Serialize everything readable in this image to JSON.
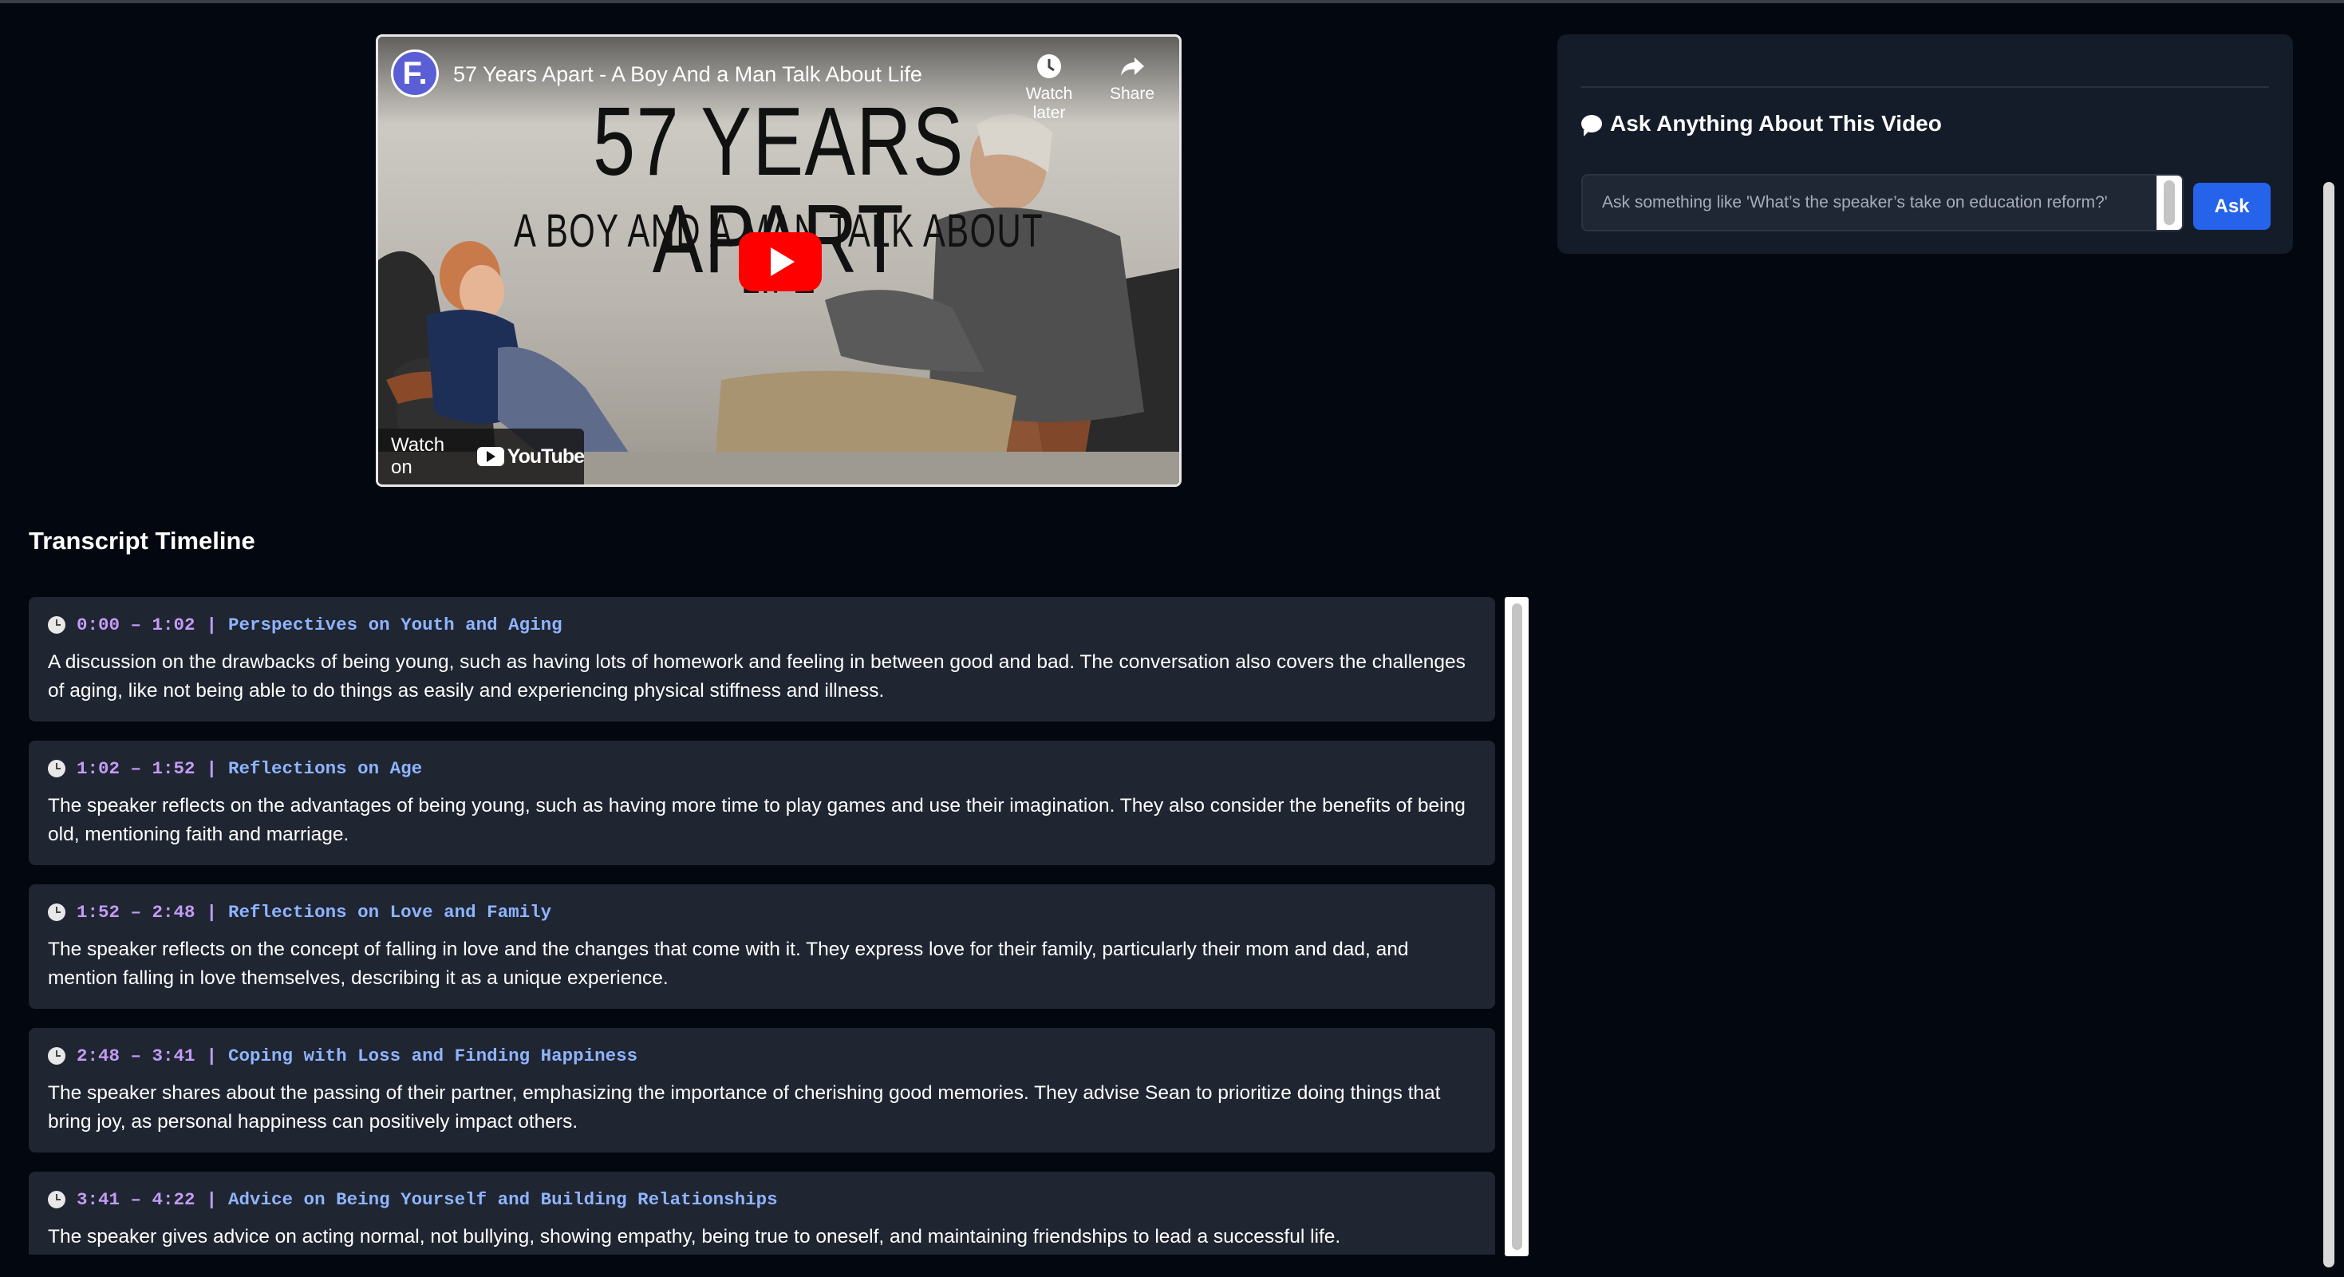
{
  "video": {
    "title": "57 Years Apart - A Boy And a Man Talk About Life",
    "channel_initial": "F.",
    "thumbnail_title": "57 YEARS APART",
    "thumbnail_subtitle": "A BOY AND A MAN TALK ABOUT LIFE",
    "watch_later_label": "Watch later",
    "share_label": "Share",
    "watch_on_label": "Watch on",
    "youtube_label": "YouTube"
  },
  "transcript": {
    "heading": "Transcript Timeline",
    "separator": "|",
    "segments": [
      {
        "time": "0:00 – 1:02",
        "topic": "Perspectives on Youth and Aging",
        "summary": "A discussion on the drawbacks of being young, such as having lots of homework and feeling in between good and bad. The conversation also covers the challenges of aging, like not being able to do things as easily and experiencing physical stiffness and illness."
      },
      {
        "time": "1:02 – 1:52",
        "topic": "Reflections on Age",
        "summary": "The speaker reflects on the advantages of being young, such as having more time to play games and use their imagination. They also consider the benefits of being old, mentioning faith and marriage."
      },
      {
        "time": "1:52 – 2:48",
        "topic": "Reflections on Love and Family",
        "summary": "The speaker reflects on the concept of falling in love and the changes that come with it. They express love for their family, particularly their mom and dad, and mention falling in love themselves, describing it as a unique experience."
      },
      {
        "time": "2:48 – 3:41",
        "topic": "Coping with Loss and Finding Happiness",
        "summary": "The speaker shares about the passing of their partner, emphasizing the importance of cherishing good memories. They advise Sean to prioritize doing things that bring joy, as personal happiness can positively impact others."
      },
      {
        "time": "3:41 – 4:22",
        "topic": "Advice on Being Yourself and Building Relationships",
        "summary": "The speaker gives advice on acting normal, not bullying, showing empathy, being true to oneself, and maintaining friendships to lead a successful life."
      }
    ]
  },
  "ask": {
    "title": "Ask Anything About This Video",
    "placeholder": "Ask something like 'What’s the speaker’s take on education reform?'",
    "value": "",
    "button_label": "Ask"
  },
  "colors": {
    "background": "#03070f",
    "card": "#1f2531",
    "timestamp": "#c39cf7",
    "topic": "#8fb4ff",
    "accent": "#2563eb",
    "youtube_red": "#ff0000"
  }
}
